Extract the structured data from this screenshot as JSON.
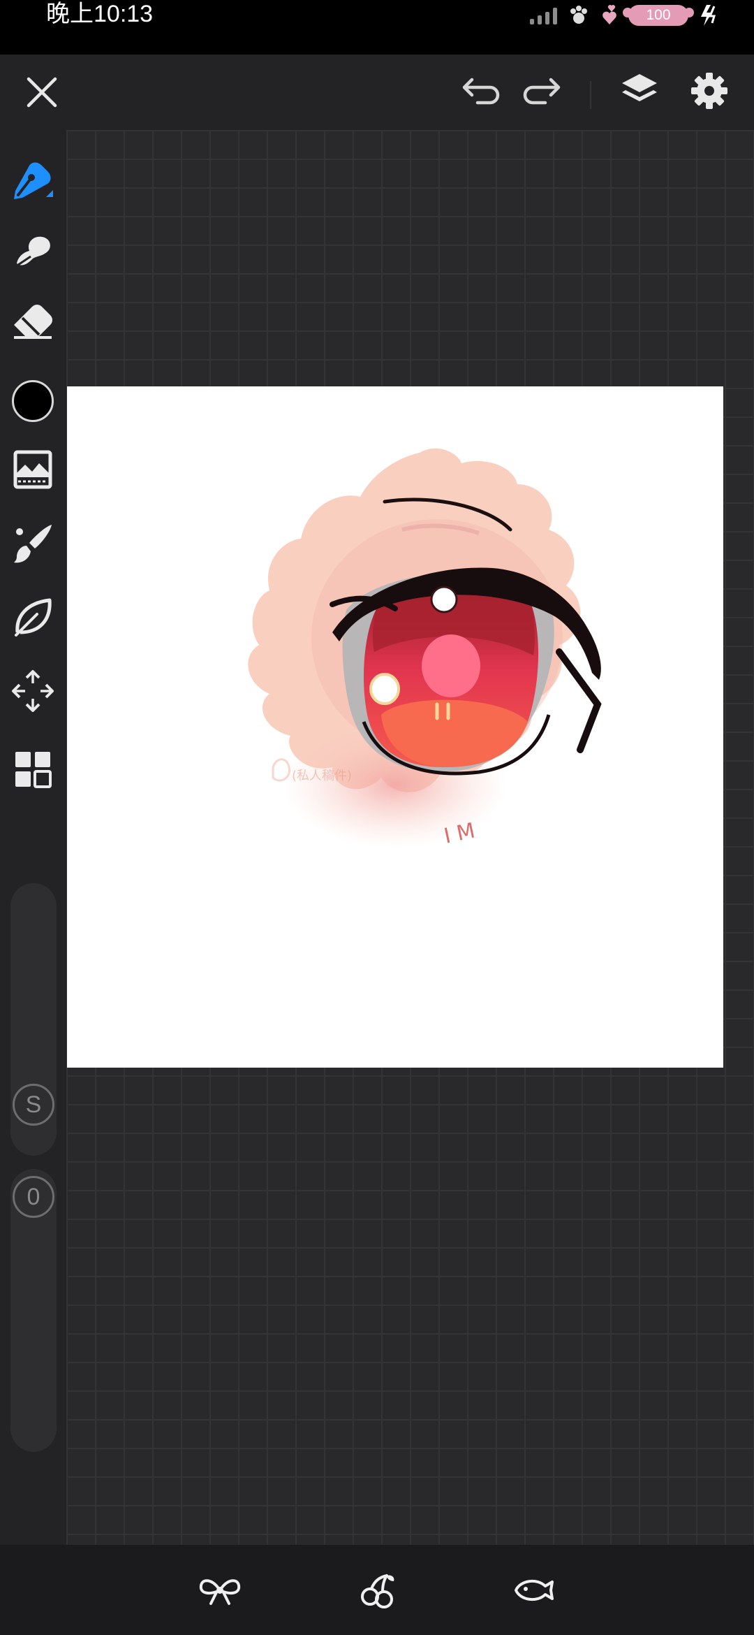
{
  "status_bar": {
    "time": "晚上10:13",
    "battery": "100"
  },
  "toolbar": {
    "close": "close-icon",
    "undo": "undo-icon",
    "redo": "redo-icon",
    "layers": "layers-icon",
    "settings": "gear-icon"
  },
  "tools": [
    {
      "name": "pen",
      "icon": "pen-icon",
      "active": true
    },
    {
      "name": "smudge",
      "icon": "smudge-icon"
    },
    {
      "name": "eraser",
      "icon": "eraser-icon"
    },
    {
      "name": "color",
      "icon": "color-swatch",
      "value": "#000000"
    },
    {
      "name": "image",
      "icon": "image-adjust-icon"
    },
    {
      "name": "brush",
      "icon": "brush-icon"
    },
    {
      "name": "lasso",
      "icon": "leaf-lasso-icon"
    },
    {
      "name": "transform",
      "icon": "move-icon"
    },
    {
      "name": "more",
      "icon": "grid-icon"
    }
  ],
  "sliders": {
    "size_label": "S",
    "opacity_label": "0"
  },
  "canvas": {
    "watermark": "(私人稿件)",
    "signature": "I M"
  },
  "bottom_bar": [
    "bow-icon",
    "cherry-icon",
    "fish-icon"
  ],
  "colors": {
    "accent": "#1e8fff",
    "background": "#29292b",
    "skin": "#f9cfc0",
    "iris": "#e2354f"
  }
}
